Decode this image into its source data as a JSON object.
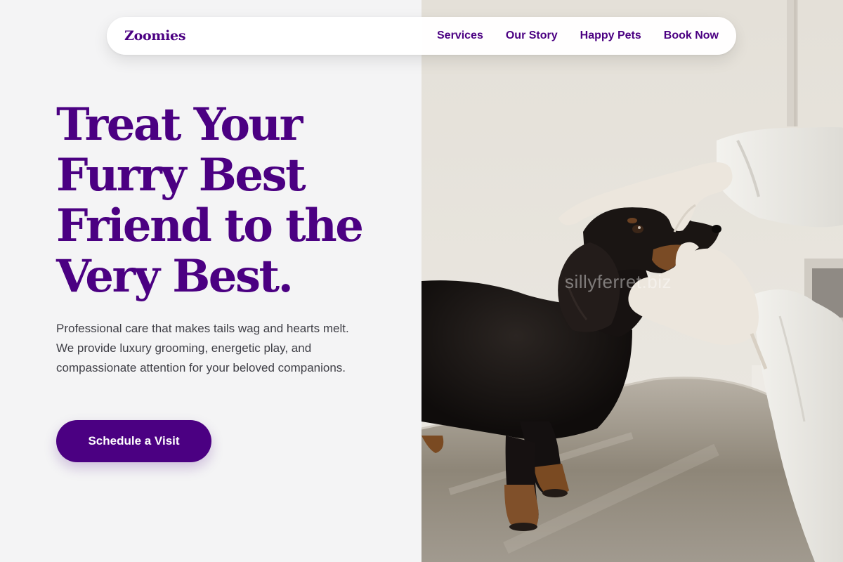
{
  "brand": {
    "name": "Zoomies",
    "primary_color": "#4b0082"
  },
  "nav": {
    "links": [
      "Services",
      "Our Story",
      "Happy Pets",
      "Book Now"
    ]
  },
  "hero": {
    "title_lines": [
      "Treat Your",
      "Furry Best",
      "Friend to the",
      "Very Best."
    ],
    "subtitle": "Professional care that makes tails wag and hearts melt. We provide luxury grooming, energetic play, and compassionate attention for your beloved companions.",
    "cta_label": "Schedule a Visit"
  },
  "photo": {
    "watermark": "sillyferret.biz"
  }
}
